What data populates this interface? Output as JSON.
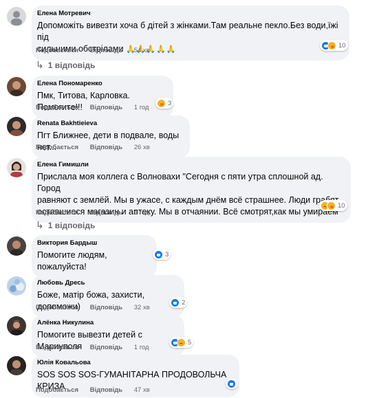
{
  "actions": {
    "like": "Подобається",
    "reply": "Відповідь"
  },
  "comments": [
    {
      "author": "Елена Мотревич",
      "text": "Допоможіть вивезти хоча б дітей з жінками.Там реальне пекло.Без води,їжі під сильними обстрілами",
      "text_lines": [
        "Допоможіть вивезти хоча б дітей з жінками.Там реальне пекло.Без води,їжі під",
        "сильними обстрілами"
      ],
      "emoji": "🙏🙏🙏🙏🙏",
      "time": "54 хв",
      "reactions": [
        "like",
        "care"
      ],
      "reaction_count": "10",
      "replies": "1 відповідь"
    },
    {
      "author": "Елена Пономаренко",
      "text": "Пмк, Титова, Карловка. Помогите!!!",
      "time": "1 год",
      "reactions": [
        "care"
      ],
      "reaction_count": "3"
    },
    {
      "author": "Renata Bakhtieieva",
      "text": "Пгт Ближнее, дети в подвале, воды нет...",
      "time": "26 хв",
      "reactions": [],
      "reaction_count": ""
    },
    {
      "author": "Елена Гимишли",
      "text_lines": [
        "Прислала моя коллега с Волновахи \"Сегодня с пяти утра сплошной ад. Город",
        "равняют с землёй. Мы в ужасе, с каждым днём всё страшнее. Люди грабят",
        "оставшиеся магазин и аптеку. Мы в отчаянии. Всё смотрят,как мы умираем\""
      ],
      "time": "1 год",
      "reactions": [
        "sad",
        "care"
      ],
      "reaction_count": "10",
      "replies": "1 відповідь"
    },
    {
      "author": "Виктория Бардыш",
      "text": "Помогите людям, пожалуйста!",
      "time": "",
      "reactions": [
        "like"
      ],
      "reaction_count": "3"
    },
    {
      "author": "Любовь Дресь",
      "text": "Боже, матір божа, захисти, допоможи)",
      "time": "32 хв",
      "reactions": [
        "like"
      ],
      "reaction_count": "2"
    },
    {
      "author": "Алёнка Никулина",
      "text": "Помогите вывезти детей с Мариуполя",
      "time": "1 год",
      "reactions": [
        "like",
        "sad"
      ],
      "reaction_count": "5"
    },
    {
      "author": "Юлія Ковальова",
      "text": "SOS SOS SOS-ГУМАНІТАРНА ПРОДОВОЛЬЧА КРИЗА",
      "time": "47 хв",
      "reactions": [
        "like"
      ],
      "reaction_count": ""
    }
  ],
  "colors": {
    "bubble": "#f0f2f5",
    "meta": "#65676b",
    "like": "#1877f2",
    "care": "#f7b125"
  }
}
